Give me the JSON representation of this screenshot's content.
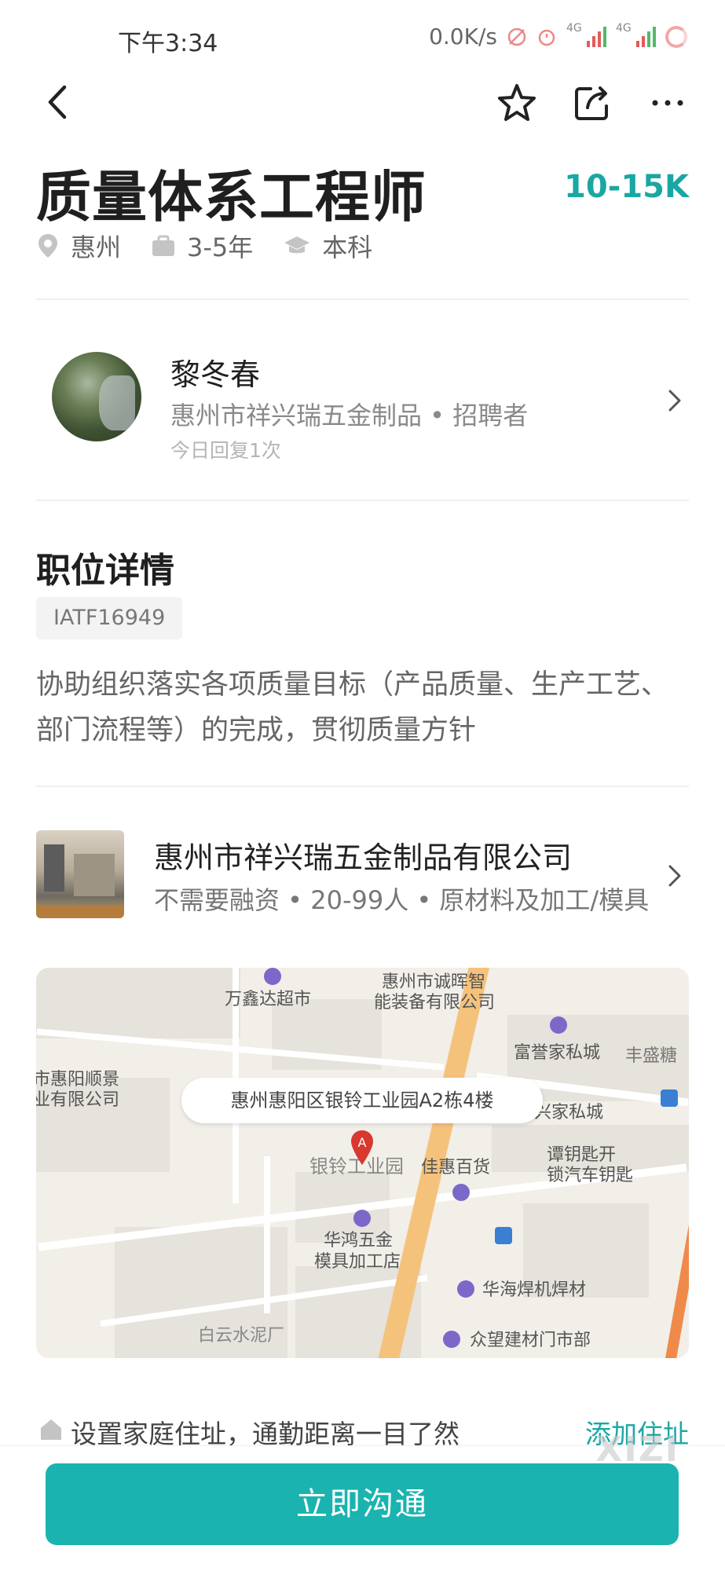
{
  "status_bar": {
    "time": "下午3:34",
    "net_speed": "0.0K/s",
    "signal_label": "4G"
  },
  "job": {
    "title": "质量体系工程师",
    "salary": "10-15K",
    "location": "惠州",
    "experience": "3-5年",
    "education": "本科"
  },
  "recruiter": {
    "name": "黎冬春",
    "company_role": "惠州市祥兴瑞五金制品 • 招聘者",
    "reply": "今日回复1次"
  },
  "details": {
    "section_title": "职位详情",
    "tag": "IATF16949",
    "description": "协助组织落实各项质量目标（产品质量、生产工艺、部门流程等）的完成，贯彻质量方针"
  },
  "company": {
    "name": "惠州市祥兴瑞五金制品有限公司",
    "info": "不需要融资 • 20-99人 • 原材料及加工/模具"
  },
  "map": {
    "address": "惠州惠阳区银铃工业园A2栋4楼",
    "pin_letter": "A",
    "labels": {
      "l1": "万鑫达超市",
      "l2": "惠州市诚晖智",
      "l3": "能装备有限公司",
      "l4": "富誉家私城",
      "l5": "丰盛糖",
      "l6": "市惠阳顺景",
      "l7": "业有限公司",
      "l8": "兴家私城",
      "l9": "谭钥匙开",
      "l10": "锁汽车钥匙",
      "l11": "银铃工业园",
      "l12": "佳惠百货",
      "l13": "华鸿五金",
      "l14": "模具加工店",
      "l15": "华海焊机焊材",
      "l16": "白云水泥厂",
      "l17": "众望建材门市部"
    }
  },
  "commute": {
    "text": "设置家庭住址，通勤距离一目了然",
    "link": "添加住址"
  },
  "cta": {
    "label": "立即沟通"
  },
  "watermark": "XIZI",
  "colors": {
    "accent": "#1aa7a4",
    "button": "#1ab3b0"
  }
}
